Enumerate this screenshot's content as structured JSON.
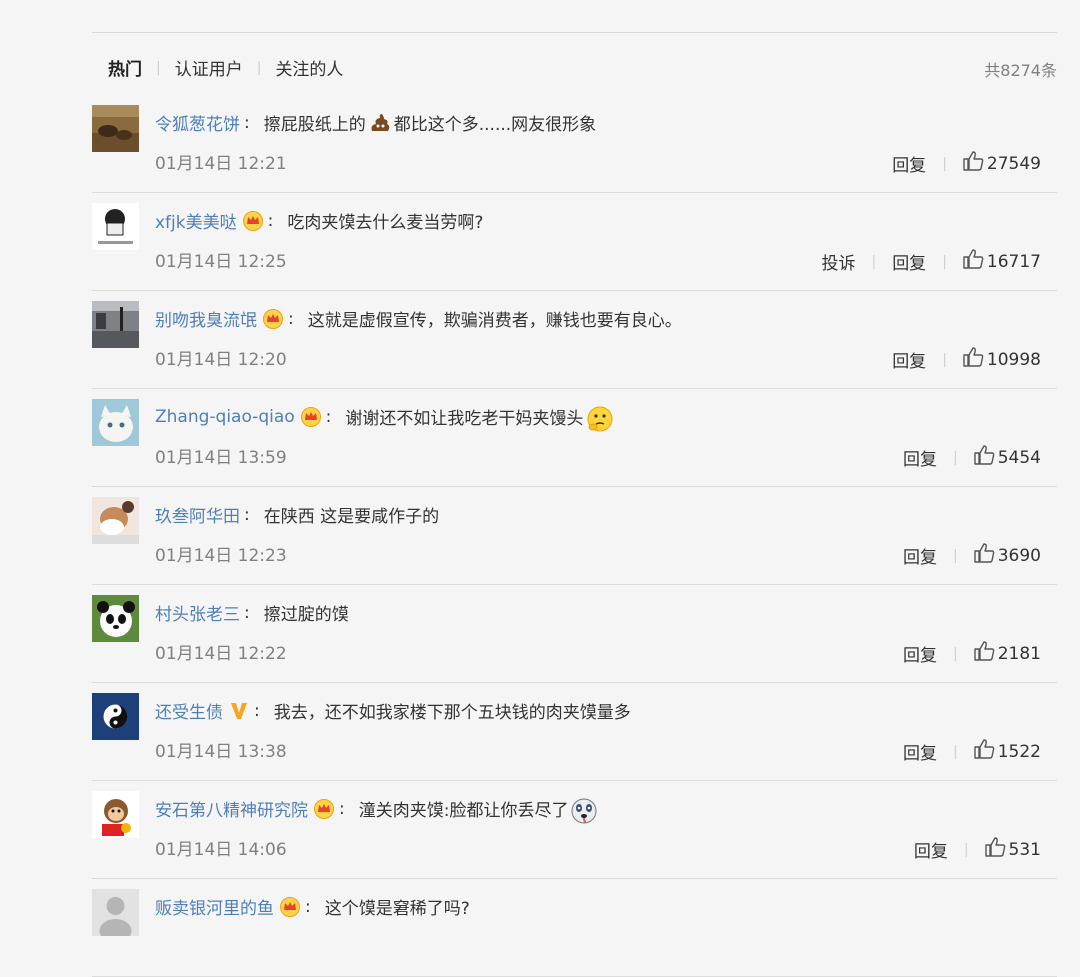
{
  "tabs": [
    "热门",
    "认证用户",
    "关注的人"
  ],
  "total": "共8274条",
  "comments": [
    {
      "user": "令狐葱花饼",
      "badge": "",
      "text": "擦屁股纸上的",
      "emoji": "poop",
      "text2": "都比这个多......网友很形象",
      "time": "01月14日 12:21",
      "report": "",
      "reply": "回复",
      "likes": "27549",
      "avatar": "brown"
    },
    {
      "user": "xfjk美美哒",
      "badge": "crown",
      "text": "吃肉夹馍去什么麦当劳啊?",
      "emoji": "",
      "text2": "",
      "time": "01月14日 12:25",
      "report": "投诉",
      "reply": "回复",
      "likes": "16717",
      "avatar": "sketch"
    },
    {
      "user": "别吻我臭流氓",
      "badge": "crown",
      "text": "这就是虚假宣传，欺骗消费者，赚钱也要有良心。",
      "emoji": "",
      "text2": "",
      "time": "01月14日 12:20",
      "report": "",
      "reply": "回复",
      "likes": "10998",
      "avatar": "street"
    },
    {
      "user": "Zhang-qiao-qiao",
      "badge": "crown",
      "text": "谢谢还不如让我吃老干妈夹馒头",
      "emoji": "think",
      "text2": "",
      "time": "01月14日 13:59",
      "report": "",
      "reply": "回复",
      "likes": "5454",
      "avatar": "cat"
    },
    {
      "user": "玖叁阿华田",
      "badge": "",
      "text": "在陕西 这是要咸作子的",
      "emoji": "",
      "text2": "",
      "time": "01月14日 12:23",
      "report": "",
      "reply": "回复",
      "likes": "3690",
      "avatar": "pet"
    },
    {
      "user": "村头张老三",
      "badge": "",
      "text": "擦过腚的馍",
      "emoji": "",
      "text2": "",
      "time": "01月14日 12:22",
      "report": "",
      "reply": "回复",
      "likes": "2181",
      "avatar": "panda"
    },
    {
      "user": "还受生债",
      "badge": "v",
      "text": "我去，还不如我家楼下那个五块钱的肉夹馍量多",
      "emoji": "",
      "text2": "",
      "time": "01月14日 13:38",
      "report": "",
      "reply": "回复",
      "likes": "1522",
      "avatar": "taiji"
    },
    {
      "user": "安石第八精神研究院",
      "badge": "crown",
      "text": "潼关肉夹馍:脸都让你丢尽了",
      "emoji": "dog",
      "text2": "",
      "time": "01月14日 14:06",
      "report": "",
      "reply": "回复",
      "likes": "531",
      "avatar": "monkey"
    },
    {
      "user": "贩卖银河里的鱼",
      "badge": "crown",
      "text": "这个馍是窘稀了吗?",
      "emoji": "",
      "text2": "",
      "time": "",
      "report": "",
      "reply": "",
      "likes": "",
      "avatar": "gray"
    }
  ]
}
